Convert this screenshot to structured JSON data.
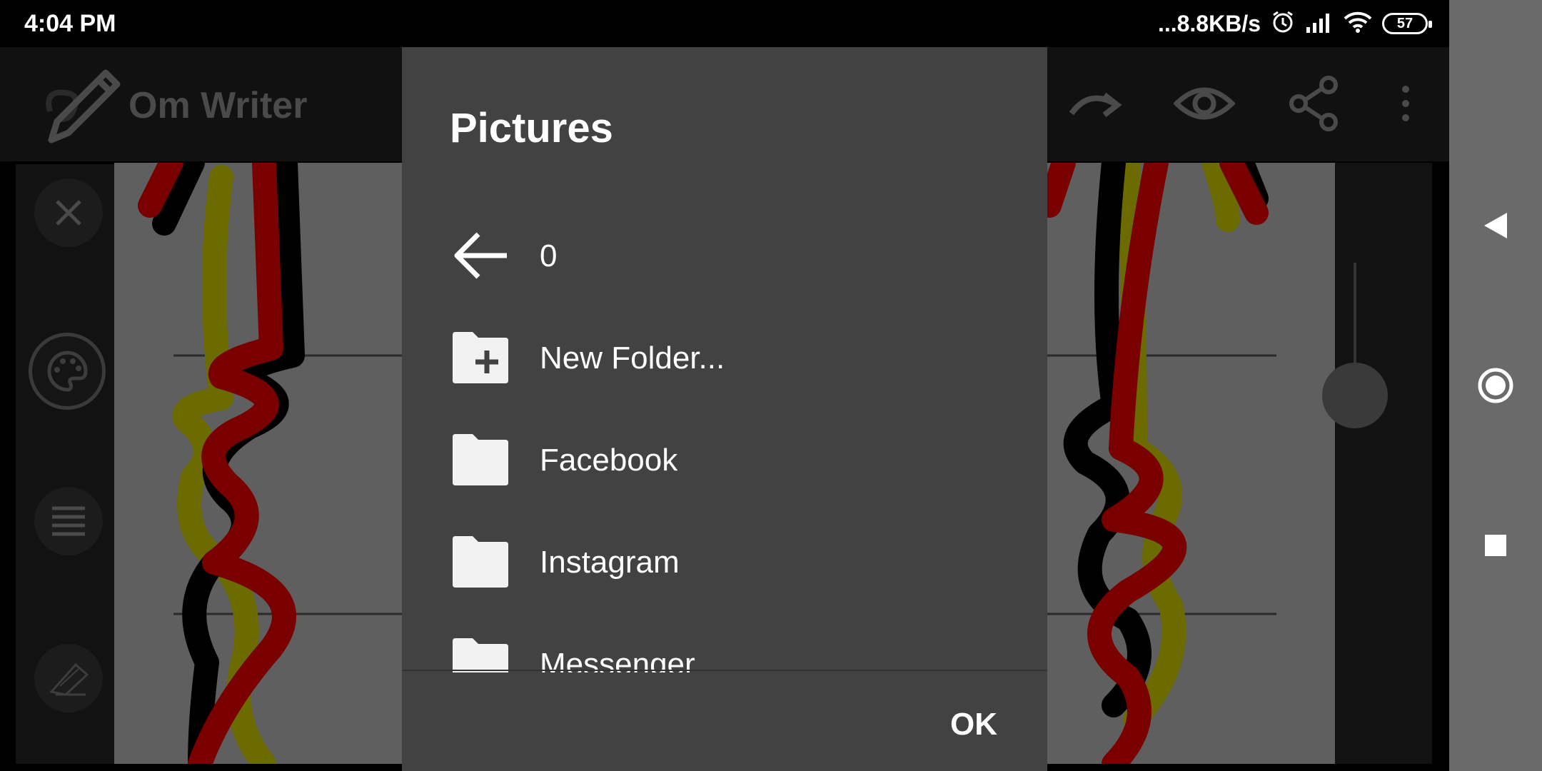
{
  "status_bar": {
    "time": "4:04 PM",
    "network_speed": "...8.8KB/s",
    "battery_level": "57",
    "icons": [
      "alarm-icon",
      "signal-icon",
      "wifi-icon",
      "battery-icon"
    ]
  },
  "app_bar": {
    "title": "Om Writer",
    "actions": [
      "redo-icon",
      "preview-eye-icon",
      "share-icon",
      "more-vert-icon"
    ]
  },
  "tool_rail": {
    "tools": [
      "close-icon",
      "palette-icon",
      "menu-lines-icon",
      "eraser-icon"
    ]
  },
  "dialog": {
    "title": "Pictures",
    "items": [
      {
        "icon": "back-arrow-icon",
        "label": "0"
      },
      {
        "icon": "new-folder-icon",
        "label": "New Folder..."
      },
      {
        "icon": "folder-icon",
        "label": "Facebook"
      },
      {
        "icon": "folder-icon",
        "label": "Instagram"
      },
      {
        "icon": "folder-icon",
        "label": "Messenger"
      }
    ],
    "ok_label": "OK"
  },
  "system_nav": {
    "buttons": [
      "back-triangle-icon",
      "home-circle-icon",
      "recents-square-icon"
    ]
  },
  "colors": {
    "dialog_bg": "#424242",
    "canvas_bg": "#5f5f5f",
    "stroke_red": "#7a0000",
    "stroke_black": "#000000",
    "stroke_yellow": "#6b6b00"
  }
}
